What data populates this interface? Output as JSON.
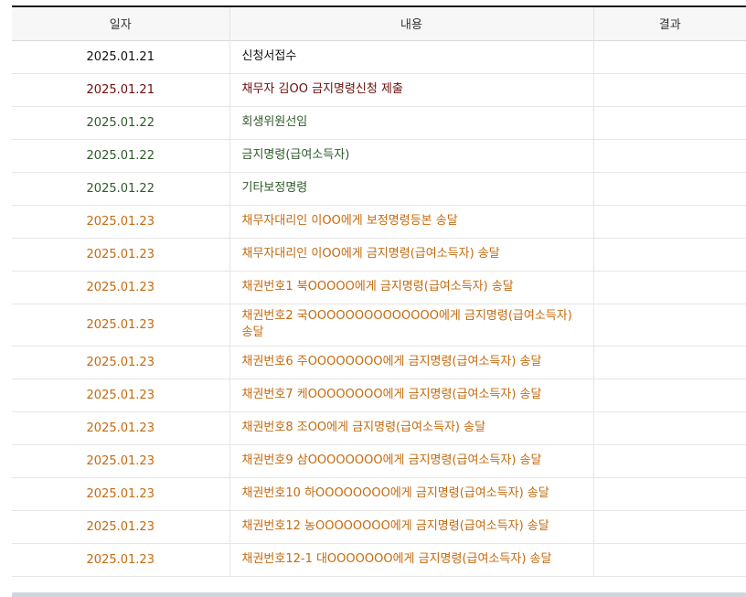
{
  "table": {
    "headers": [
      "일자",
      "내용",
      "결과"
    ],
    "rows": [
      {
        "date": "2025.01.21",
        "content": "신청서접수",
        "result": "",
        "style": "black"
      },
      {
        "date": "2025.01.21",
        "content": "채무자 김OO 금지명령신청 제출",
        "result": "",
        "style": "maroon"
      },
      {
        "date": "2025.01.22",
        "content": "회생위원선임",
        "result": "",
        "style": "green"
      },
      {
        "date": "2025.01.22",
        "content": "금지명령(급여소득자)",
        "result": "",
        "style": "green"
      },
      {
        "date": "2025.01.22",
        "content": "기타보정명령",
        "result": "",
        "style": "green"
      },
      {
        "date": "2025.01.23",
        "content": "채무자대리인 이OO에게 보정명령등본 송달",
        "result": "",
        "style": "orange"
      },
      {
        "date": "2025.01.23",
        "content": "채무자대리인 이OO에게 금지명령(급여소득자) 송달",
        "result": "",
        "style": "orange"
      },
      {
        "date": "2025.01.23",
        "content": "채권번호1 북OOOOO에게 금지명령(급여소득자) 송달",
        "result": "",
        "style": "orange"
      },
      {
        "date": "2025.01.23",
        "content": "채권번호2 국OOOOOOOOOOOOOO에게 금지명령(급여소득자) 송달",
        "result": "",
        "style": "orange",
        "tall": true
      },
      {
        "date": "2025.01.23",
        "content": "채권번호6 주OOOOOOOO에게 금지명령(급여소득자) 송달",
        "result": "",
        "style": "orange"
      },
      {
        "date": "2025.01.23",
        "content": "채권번호7 케OOOOOOOO에게 금지명령(급여소득자) 송달",
        "result": "",
        "style": "orange"
      },
      {
        "date": "2025.01.23",
        "content": "채권번호8 조OO에게 금지명령(급여소득자) 송달",
        "result": "",
        "style": "orange"
      },
      {
        "date": "2025.01.23",
        "content": "채권번호9 삼OOOOOOOO에게 금지명령(급여소득자) 송달",
        "result": "",
        "style": "orange"
      },
      {
        "date": "2025.01.23",
        "content": "채권번호10 하OOOOOOOO에게 금지명령(급여소득자) 송달",
        "result": "",
        "style": "orange"
      },
      {
        "date": "2025.01.23",
        "content": "채권번호12 농OOOOOOOO에게 금지명령(급여소득자) 송달",
        "result": "",
        "style": "orange"
      },
      {
        "date": "2025.01.23",
        "content": "채권번호12-1 대OOOOOOO에게 금지명령(급여소득자) 송달",
        "result": "",
        "style": "orange"
      }
    ]
  },
  "colors": {
    "black": "#111111",
    "maroon": "#6b0d0d",
    "green": "#2f5a2a",
    "orange": "#c56a0e",
    "header_border": "#1a1a1a",
    "header_bg": "#f7f7f7"
  }
}
